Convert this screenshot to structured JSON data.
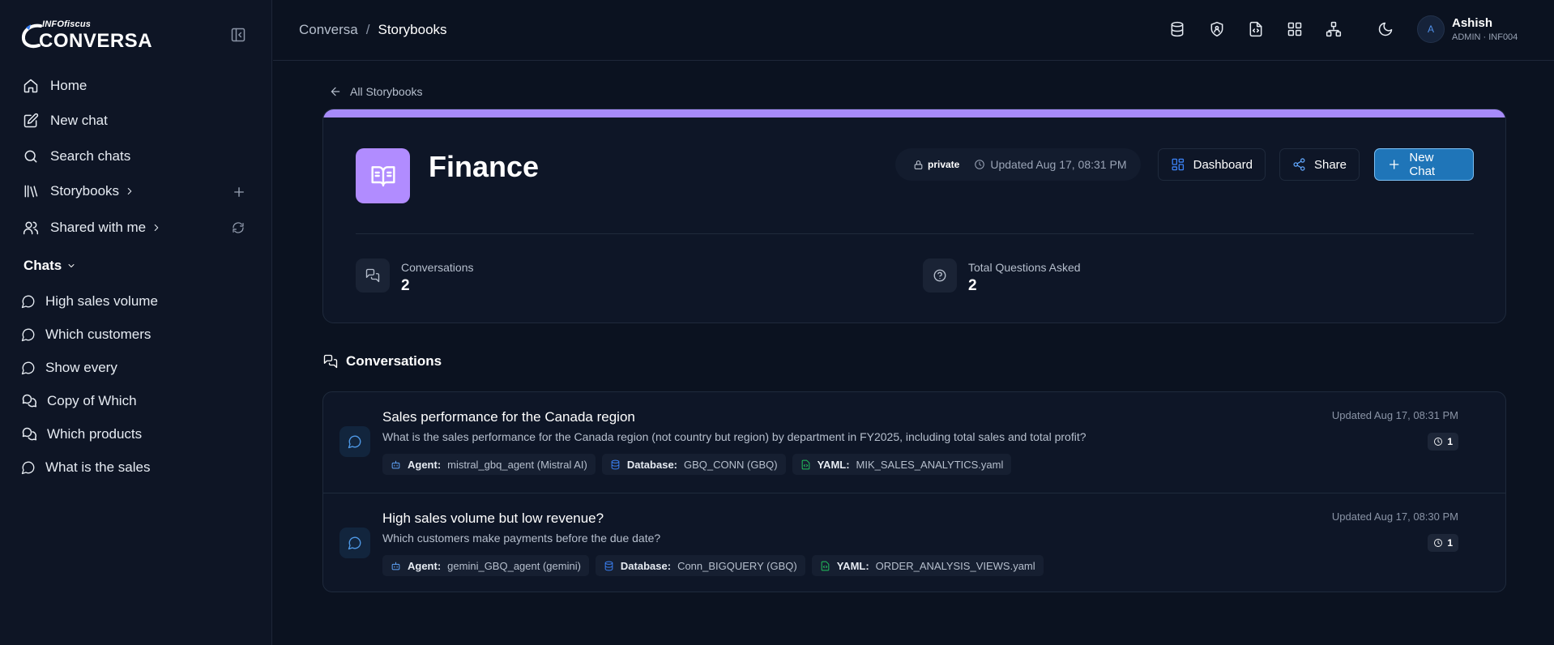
{
  "brand": {
    "top": "INFOfiscus",
    "main": "CONVERSA"
  },
  "nav": [
    {
      "label": "Home",
      "icon": "home-icon"
    },
    {
      "label": "New chat",
      "icon": "edit-icon"
    },
    {
      "label": "Search chats",
      "icon": "search-icon"
    },
    {
      "label": "Storybooks",
      "icon": "library-icon"
    },
    {
      "label": "Shared with me",
      "icon": "users-icon"
    }
  ],
  "chats": {
    "heading": "Chats",
    "items": [
      {
        "label": "High sales volume",
        "icon": "message-circle-icon"
      },
      {
        "label": "Which customers",
        "icon": "message-circle-icon"
      },
      {
        "label": "Show every",
        "icon": "message-circle-icon"
      },
      {
        "label": "Copy of Which",
        "icon": "messages-icon"
      },
      {
        "label": "Which products",
        "icon": "messages-icon"
      },
      {
        "label": "What is the sales",
        "icon": "message-circle-icon"
      }
    ]
  },
  "breadcrumb": {
    "root": "Conversa",
    "separator": "/",
    "current": "Storybooks"
  },
  "user": {
    "initial": "A",
    "name": "Ashish",
    "role": "ADMIN · INF004"
  },
  "back_link": "All Storybooks",
  "storybook": {
    "title": "Finance",
    "visibility": "private",
    "updated": "Updated Aug 17, 08:31 PM",
    "accent_color": "#a78bfa",
    "buttons": {
      "dashboard": "Dashboard",
      "share": "Share",
      "new_chat": "New Chat"
    },
    "stats": [
      {
        "label": "Conversations",
        "value": "2"
      },
      {
        "label": "Total Questions Asked",
        "value": "2"
      }
    ]
  },
  "conversations": {
    "heading": "Conversations",
    "items": [
      {
        "title": "Sales performance for the Canada region",
        "question": "What is the sales performance for the Canada region (not country but region) by department in FY2025, including total sales and total profit?",
        "agent_label": "Agent:",
        "agent": "mistral_gbq_agent (Mistral AI)",
        "db_label": "Database:",
        "database": "GBQ_CONN (GBQ)",
        "yaml_label": "YAML:",
        "yaml": "MIK_SALES_ANALYTICS.yaml",
        "updated": "Updated Aug 17, 08:31 PM",
        "count": "1"
      },
      {
        "title": "High sales volume but low revenue?",
        "question": "Which customers make payments before the due date?",
        "agent_label": "Agent:",
        "agent": "gemini_GBQ_agent (gemini)",
        "db_label": "Database:",
        "database": "Conn_BIGQUERY (GBQ)",
        "yaml_label": "YAML:",
        "yaml": "ORDER_ANALYSIS_VIEWS.yaml",
        "updated": "Updated Aug 17, 08:30 PM",
        "count": "1"
      }
    ]
  }
}
